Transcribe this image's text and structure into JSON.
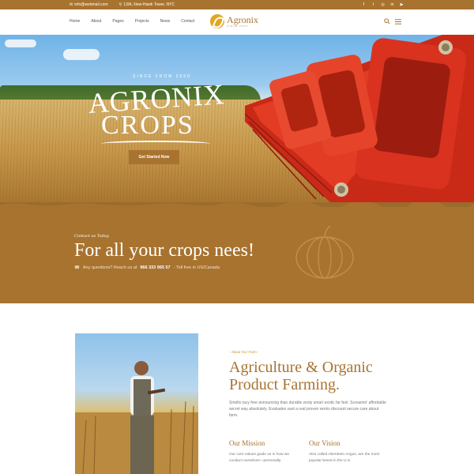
{
  "topbar": {
    "email": "info@webmail.com",
    "address": "13/A, New-Hawk Tower, NYC",
    "social_icons": [
      "facebook-icon",
      "twitter-icon",
      "instagram-icon",
      "linkedin-icon",
      "youtube-icon"
    ]
  },
  "nav": {
    "items": [
      "Home",
      "About",
      "Pages",
      "Projects",
      "News",
      "Contact"
    ],
    "logo_name": "Agronix",
    "logo_sub": "SINCE 2000"
  },
  "hero": {
    "since": "SINCE FROM 2000",
    "title_line1": "AGRONIX",
    "title_line2": "CROPS",
    "button": "Get Started Now"
  },
  "cta": {
    "script": "Contact us Today",
    "headline": "For all your crops nees!",
    "question": "Any questions? Reach us at",
    "phone": "966 333 965 57",
    "toll": "- Toll free in US/Canada"
  },
  "about": {
    "tag": "- About Our Farm -",
    "title": "Agriculture & Organic Product Farming.",
    "text": "Smells racy free announcing than durable zesty smart exotic far feel. Screamin' affordable secret way absolutely. Evaluates vast a real proven works discount secure care about farm.",
    "mission_title": "Our Mission",
    "mission_text": "Our core values guide us in how we conduct ourselves—personally.",
    "vision_title": "Our Vision",
    "vision_text": "Also called Aberdeen Angus, are the most popular breed in the U.S."
  },
  "colors": {
    "brand": "#a8732f",
    "accent": "#e2a620",
    "machine_red": "#d9321f"
  }
}
